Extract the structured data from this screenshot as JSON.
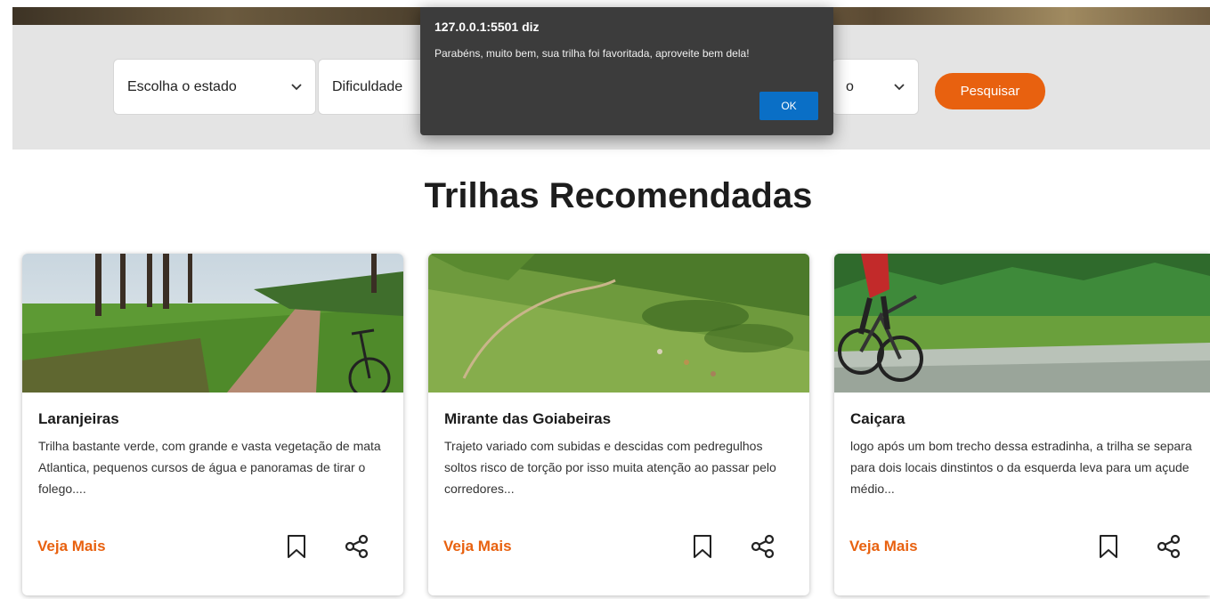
{
  "search": {
    "estado_label": "Escolha o estado",
    "dificuldade_label": "Dificuldade",
    "third_select_fragment": "o",
    "button_label": "Pesquisar"
  },
  "section": {
    "title": "Trilhas Recomendadas"
  },
  "cards": [
    {
      "title": "Laranjeiras",
      "description": "Trilha bastante verde, com grande e vasta vegetação de mata Atlantica, pequenos cursos de água e panoramas de tirar o folego....",
      "link": "Veja Mais"
    },
    {
      "title": "Mirante das Goiabeiras",
      "description": "Trajeto variado com subidas e descidas com pedregulhos soltos risco de torção por isso muita atenção ao passar pelo corredores...",
      "link": "Veja Mais"
    },
    {
      "title": "Caiçara",
      "description": "logo após um bom trecho dessa estradinha, a trilha se separa para dois locais dinstintos o da esquerda leva para um açude médio...",
      "link": "Veja Mais"
    }
  ],
  "alert": {
    "origin": "127.0.0.1:5501 diz",
    "message": "Parabéns, muito bem, sua trilha foi favoritada, aproveite bem dela!",
    "ok_label": "OK"
  },
  "colors": {
    "accent": "#e8610f",
    "alert_bg": "#3c3c3c",
    "alert_button": "#0a6fc6",
    "search_bg": "#e4e4e4"
  },
  "icons": [
    "chevron-down-icon",
    "bookmark-icon",
    "share-icon"
  ]
}
